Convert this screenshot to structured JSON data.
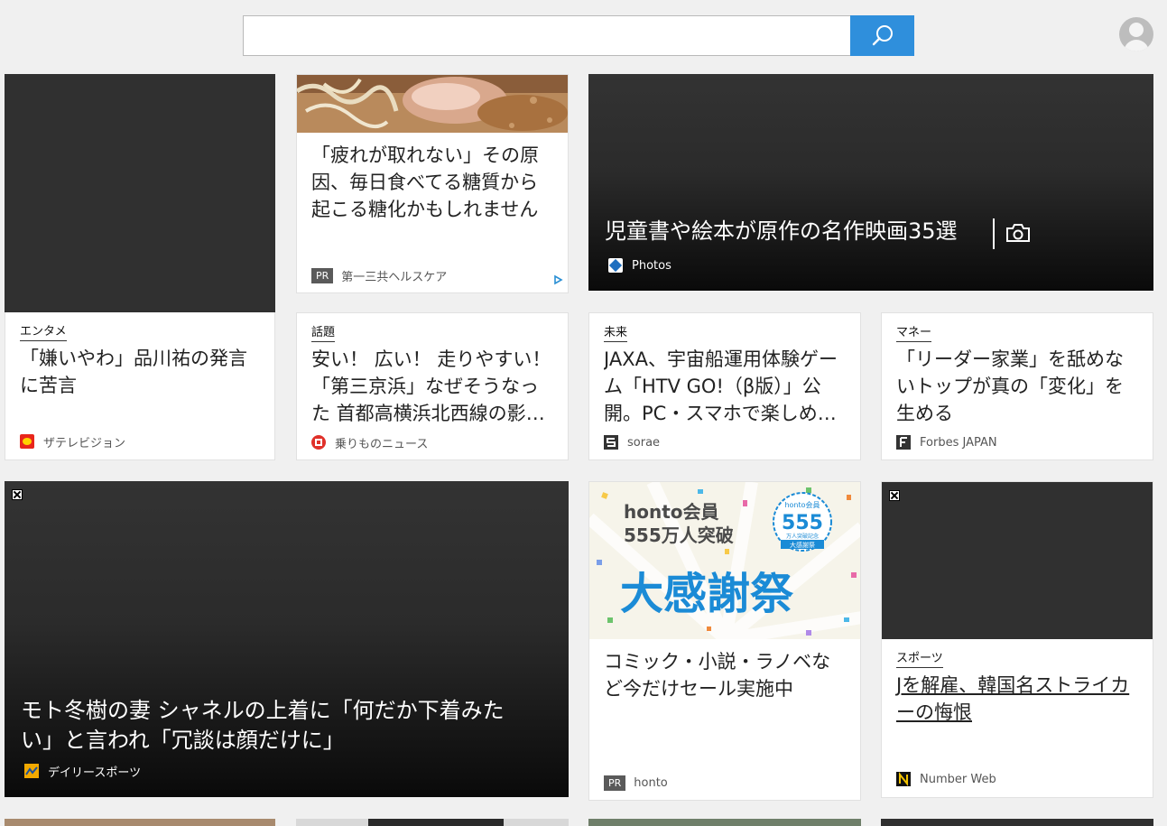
{
  "header": {
    "search_value": "",
    "search_icon": "search-icon",
    "avatar_icon": "user-avatar-icon",
    "accent": "#2f8fdc"
  },
  "cards": {
    "ad_glycation": {
      "title": "「疲れが取れない」その原因、毎日食べてる糖質から起こる糖化かもしれません",
      "pr": "PR",
      "source": "第一三共ヘルスケア"
    },
    "hero_films": {
      "title": "児童書や絵本が原作の名作映画35選",
      "source": "Photos"
    },
    "entame": {
      "category": "エンタメ",
      "title": "「嫌いやわ」品川祐の発言に苦言",
      "source": "ザテレビジョン"
    },
    "wadai": {
      "category": "話題",
      "title": "安い！ 広い！ 走りやすい！「第三京浜」なぜそうなった 首都高横浜北西線の影響…",
      "source": "乗りものニュース"
    },
    "mirai": {
      "category": "未来",
      "title": "JAXA、宇宙船運用体験ゲーム「HTV GO!（β版）」公開。PC・スマホで楽しめる…",
      "source": "sorae"
    },
    "money": {
      "category": "マネー",
      "title": "「リーダー家業」を舐めないトップが真の「変化」を生める",
      "source": "Forbes JAPAN"
    },
    "moto": {
      "title": "モト冬樹の妻 シャネルの上着に「何だか下着みたい」と言われ「冗談は顔だけに」",
      "source": "デイリースポーツ"
    },
    "honto": {
      "banner_line1": "honto会員",
      "banner_line2": "555万人突破",
      "banner_big": "大感謝祭",
      "badge_top": "honto会員",
      "badge_num": "555",
      "badge_sub": "万人突破記念",
      "badge_bottom": "大感謝祭",
      "title": "コミック・小説・ラノベなど今だけセール実施中",
      "pr": "PR",
      "source": "honto"
    },
    "sports": {
      "category": "スポーツ",
      "title": "Jを解雇、韓国名ストライカーの悔恨",
      "source": "Number Web"
    }
  }
}
